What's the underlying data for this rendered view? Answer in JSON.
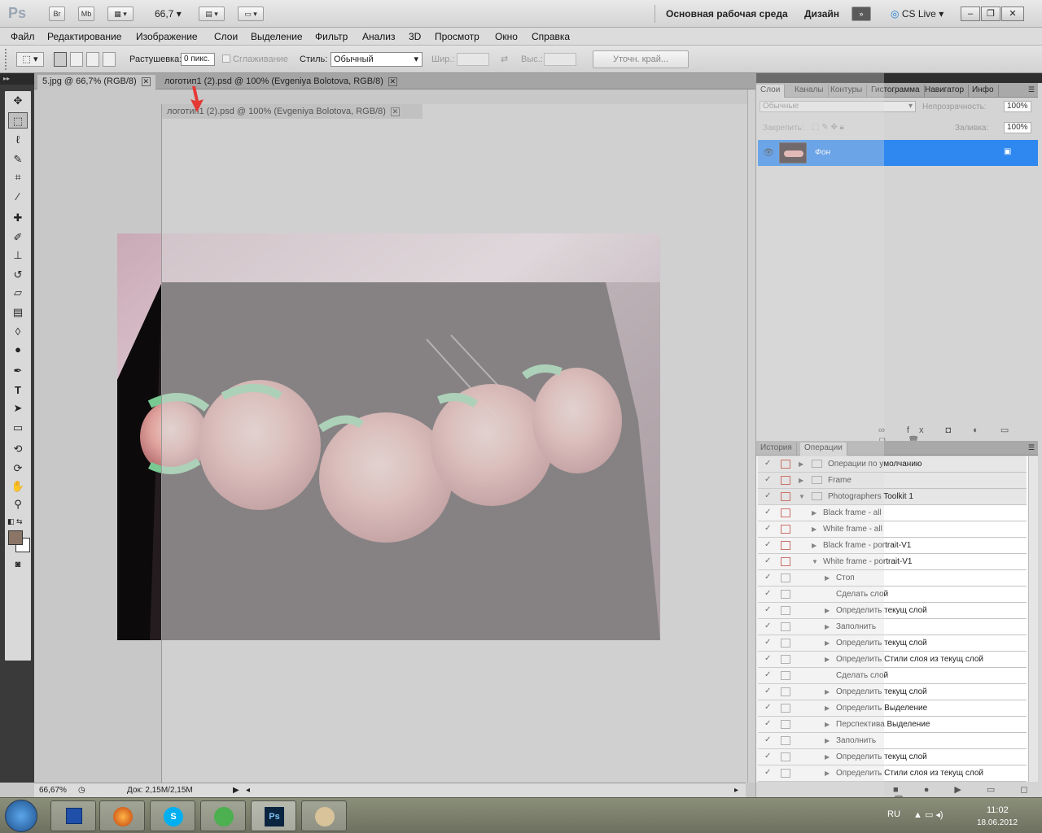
{
  "appbar": {
    "logo": "Ps",
    "br": "Br",
    "mb": "Mb",
    "zoom": "66,7",
    "workspace": "Основная рабочая среда",
    "design": "Дизайн",
    "cslive": "CS Live"
  },
  "menu": [
    "Файл",
    "Редактирование",
    "Изображение",
    "Слои",
    "Выделение",
    "Фильтр",
    "Анализ",
    "3D",
    "Просмотр",
    "Окно",
    "Справка"
  ],
  "options": {
    "feather_label": "Растушевка:",
    "feather_value": "0 пикс.",
    "antialias_label": "Сглаживание",
    "style_label": "Стиль:",
    "style_value": "Обычный",
    "width_label": "Шир.:",
    "height_label": "Выс.:",
    "refine_edge": "Уточн. край..."
  },
  "doc_tabs": [
    {
      "label": "5.jpg @ 66,7% (RGB/8)",
      "active": true
    },
    {
      "label": "логотип1 (2).psd @ 100% (Evgeniya Bolotova, RGB/8)",
      "active": false
    }
  ],
  "floating_tab": "логотип1 (2).psd @ 100% (Evgeniya Bolotova, RGB/8)",
  "status": {
    "zoom": "66,67%",
    "doc": "Док: 2,15M/2,15M"
  },
  "layers_panel": {
    "tabs": [
      "Слои",
      "Каналы",
      "Контуры",
      "Гистограмма",
      "Навигатор",
      "Инфо"
    ],
    "blend_mode": "Обычные",
    "opacity_label": "Непрозрачность:",
    "opacity_value": "100%",
    "lock_label": "Закрепить:",
    "fill_label": "Заливка:",
    "fill_value": "100%",
    "layer_name": "Фон"
  },
  "actions_panel": {
    "tabs": [
      "История",
      "Операции"
    ],
    "rows": [
      {
        "label": "Операции по умолчанию",
        "indent": 0,
        "tri": "▶",
        "folder": true,
        "red": true
      },
      {
        "label": "Frame",
        "indent": 0,
        "tri": "▶",
        "folder": true,
        "red": true
      },
      {
        "label": "Photographers Toolkit 1",
        "indent": 0,
        "tri": "▼",
        "folder": true,
        "red": true
      },
      {
        "label": "Black frame - all",
        "indent": 1,
        "tri": "▶",
        "folder": false,
        "red": true
      },
      {
        "label": "White frame - all",
        "indent": 1,
        "tri": "▶",
        "folder": false,
        "red": true
      },
      {
        "label": "Black frame - portrait-V1",
        "indent": 1,
        "tri": "▶",
        "folder": false,
        "red": true
      },
      {
        "label": "White frame - portrait-V1",
        "indent": 1,
        "tri": "▼",
        "folder": false,
        "red": true
      },
      {
        "label": "Стоп",
        "indent": 2,
        "tri": "▶",
        "folder": false,
        "red": false,
        "dlg": true
      },
      {
        "label": "Сделать слой",
        "indent": 2,
        "tri": "",
        "folder": false,
        "red": false
      },
      {
        "label": "Определить текущ слой",
        "indent": 2,
        "tri": "▶",
        "folder": false,
        "red": false
      },
      {
        "label": "Заполнить",
        "indent": 2,
        "tri": "▶",
        "folder": false,
        "red": false
      },
      {
        "label": "Определить текущ слой",
        "indent": 2,
        "tri": "▶",
        "folder": false,
        "red": false
      },
      {
        "label": "Определить Стили слоя из текущ слой",
        "indent": 2,
        "tri": "▶",
        "folder": false,
        "red": false
      },
      {
        "label": "Сделать слой",
        "indent": 2,
        "tri": "",
        "folder": false,
        "red": false
      },
      {
        "label": "Определить текущ слой",
        "indent": 2,
        "tri": "▶",
        "folder": false,
        "red": false
      },
      {
        "label": "Определить Выделение",
        "indent": 2,
        "tri": "▶",
        "folder": false,
        "red": false
      },
      {
        "label": "Перспектива Выделение",
        "indent": 2,
        "tri": "▶",
        "folder": false,
        "red": false
      },
      {
        "label": "Заполнить",
        "indent": 2,
        "tri": "▶",
        "folder": false,
        "red": false
      },
      {
        "label": "Определить текущ слой",
        "indent": 2,
        "tri": "▶",
        "folder": false,
        "red": false
      },
      {
        "label": "Определить Стили слоя из текущ слой",
        "indent": 2,
        "tri": "▶",
        "folder": false,
        "red": false
      }
    ]
  },
  "taskbar": {
    "lang": "RU",
    "time": "11:02",
    "date": "18.06.2012"
  }
}
